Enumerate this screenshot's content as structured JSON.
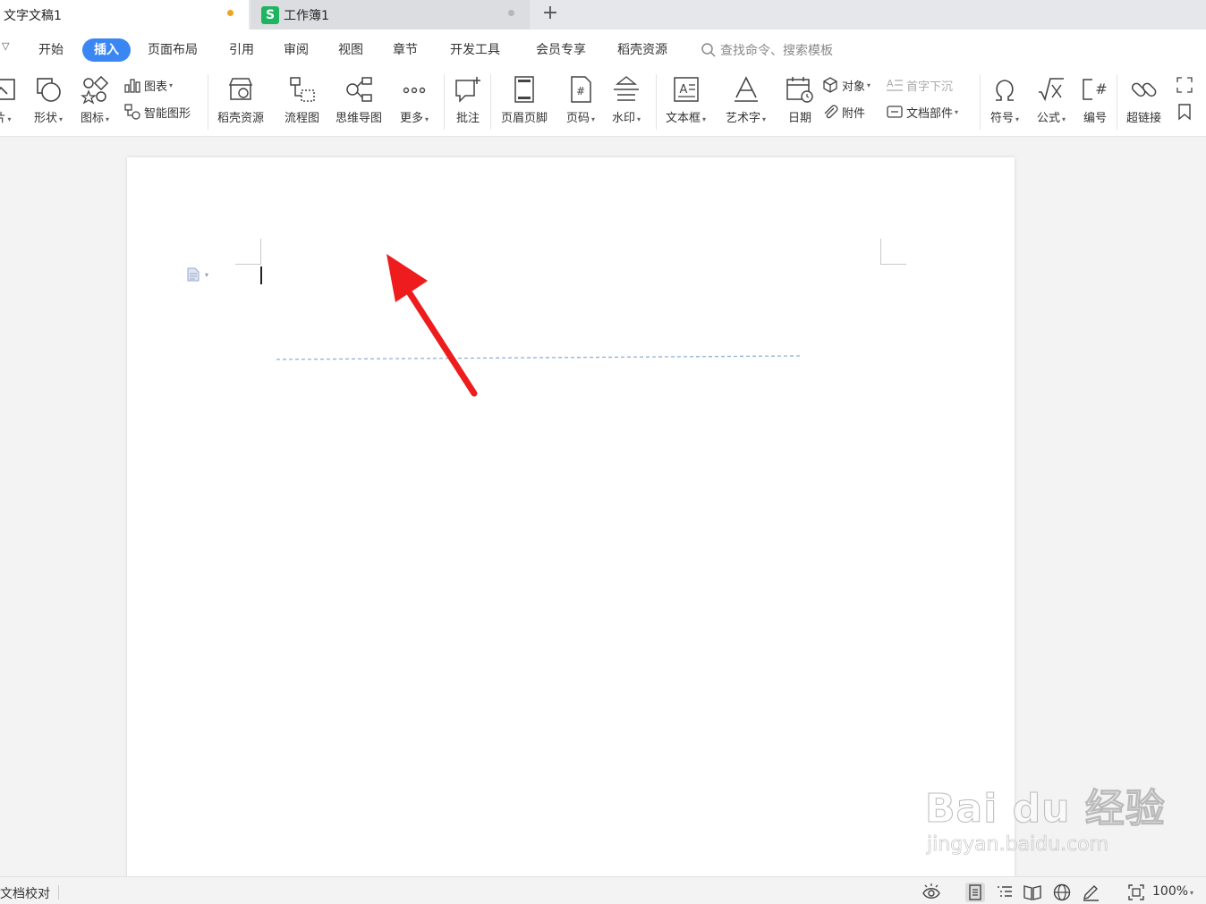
{
  "tabs": [
    {
      "label": "文字文稿1",
      "active": true
    },
    {
      "label": "工作簿1",
      "active": false,
      "logo": "S"
    }
  ],
  "menu": {
    "items": [
      "开始",
      "插入",
      "页面布局",
      "引用",
      "审阅",
      "视图",
      "章节",
      "开发工具",
      "会员专享",
      "稻壳资源"
    ],
    "active": "插入",
    "search_placeholder": "查找命令、搜索模板"
  },
  "ribbon": {
    "picture": "片",
    "shape": "形状",
    "icon": "图标",
    "chart": "图表",
    "smart_art": "智能图形",
    "docer": "稻壳资源",
    "flowchart": "流程图",
    "mindmap": "思维导图",
    "more": "更多",
    "comment": "批注",
    "header_footer": "页眉页脚",
    "page_number": "页码",
    "watermark": "水印",
    "textbox": "文本框",
    "wordart": "艺术字",
    "date": "日期",
    "object": "对象",
    "attachment": "附件",
    "drop_cap": "首字下沉",
    "doc_parts": "文档部件",
    "symbol": "符号",
    "formula": "公式",
    "numbering": "编号",
    "hyperlink": "超链接"
  },
  "status": {
    "proofread": "文档校对",
    "zoom": "100%"
  },
  "watermark": {
    "main": "Bai du 经验",
    "sub": "jingyan.baidu.com"
  },
  "colors": {
    "accent": "#3a87f3",
    "arrow": "#ee1c1c",
    "sheet_logo": "#1fb462",
    "unsaved_dot": "#f0a321"
  }
}
